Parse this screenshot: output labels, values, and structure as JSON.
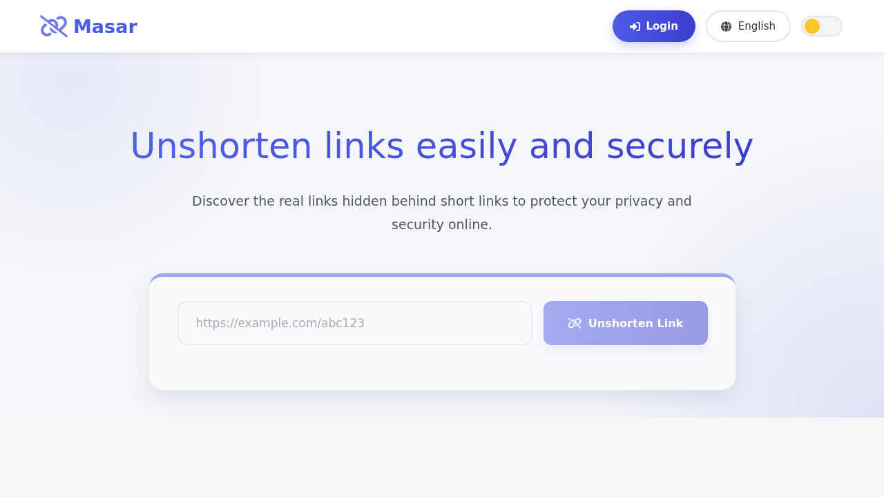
{
  "header": {
    "logo": "Masar",
    "login_button": "Login",
    "language_button": "English",
    "theme_toggle": {
      "on": false
    }
  },
  "hero": {
    "title": "Unshorten links easily and securely",
    "subtitle": "Discover the real links hidden behind short links to protect your privacy and security online."
  },
  "form": {
    "url_field": {
      "placeholder": "https://example.com/abc123"
    },
    "submit_button": {
      "label": "Unshorten Link",
      "disabled": true
    }
  }
}
